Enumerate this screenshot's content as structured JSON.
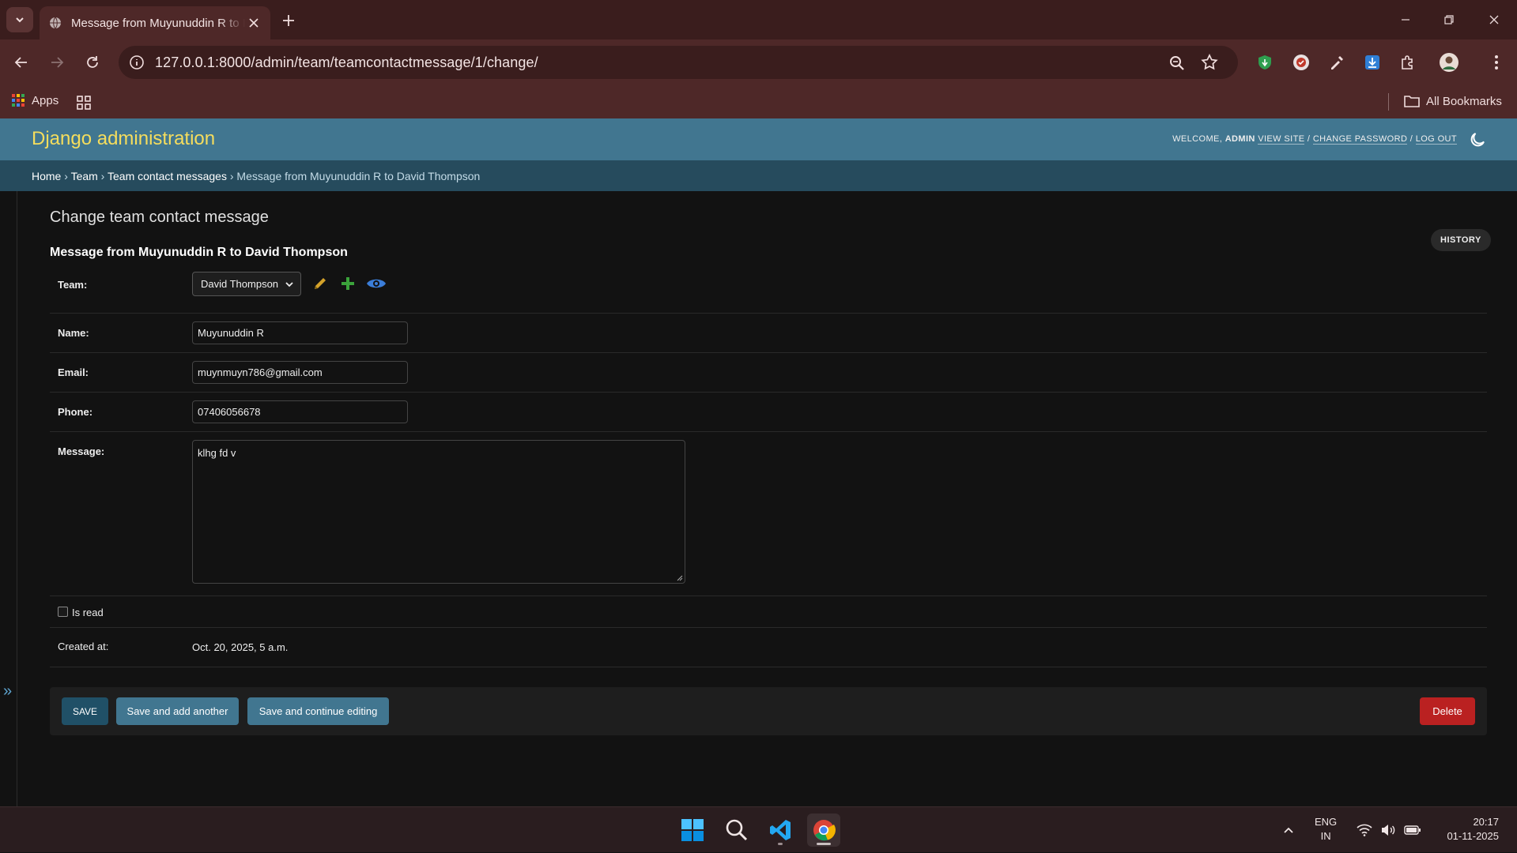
{
  "browser": {
    "tab_title": "Message from Muyunuddin R to David Thompson",
    "url": "127.0.0.1:8000/admin/team/teamcontactmessage/1/change/",
    "bookmarks": {
      "apps_label": "Apps",
      "all_bookmarks_label": "All Bookmarks"
    }
  },
  "admin": {
    "site_name": "Django administration",
    "user_tools": {
      "welcome": "Welcome,",
      "username": "admin",
      "view_site": "View site",
      "change_password": "Change password",
      "log_out": "Log out",
      "sep": " / "
    },
    "breadcrumbs": {
      "home": "Home",
      "app": "Team",
      "model": "Team contact messages",
      "current": "Message from Muyunuddin R to David Thompson",
      "sep": " › "
    },
    "page_title": "Change team contact message",
    "history_label": "History",
    "object_title": "Message from Muyunuddin R to David Thompson",
    "fields": {
      "team": {
        "label": "Team:",
        "value": "David Thompson"
      },
      "name": {
        "label": "Name:",
        "value": "Muyunuddin R"
      },
      "email": {
        "label": "Email:",
        "value": "muynmuyn786@gmail.com"
      },
      "phone": {
        "label": "Phone:",
        "value": "07406056678"
      },
      "message": {
        "label": "Message:",
        "value": "klhg fd v"
      },
      "is_read": {
        "label": "Is read",
        "checked": false
      },
      "created_at": {
        "label": "Created at:",
        "value": "Oct. 20, 2025, 5 a.m."
      }
    },
    "buttons": {
      "save": "Save",
      "save_add_another": "Save and add another",
      "save_continue": "Save and continue editing",
      "delete": "Delete"
    },
    "colors": {
      "header_bg": "#417690",
      "branding": "#f5dd5d",
      "breadcrumbs_bg": "#264b5d",
      "delete": "#ba2121"
    }
  },
  "taskbar": {
    "lang_top": "ENG",
    "lang_bottom": "IN",
    "time": "20:17",
    "date": "01-11-2025",
    "icons": [
      "windows-start-icon",
      "search-icon",
      "vscode-icon",
      "chrome-icon"
    ]
  }
}
